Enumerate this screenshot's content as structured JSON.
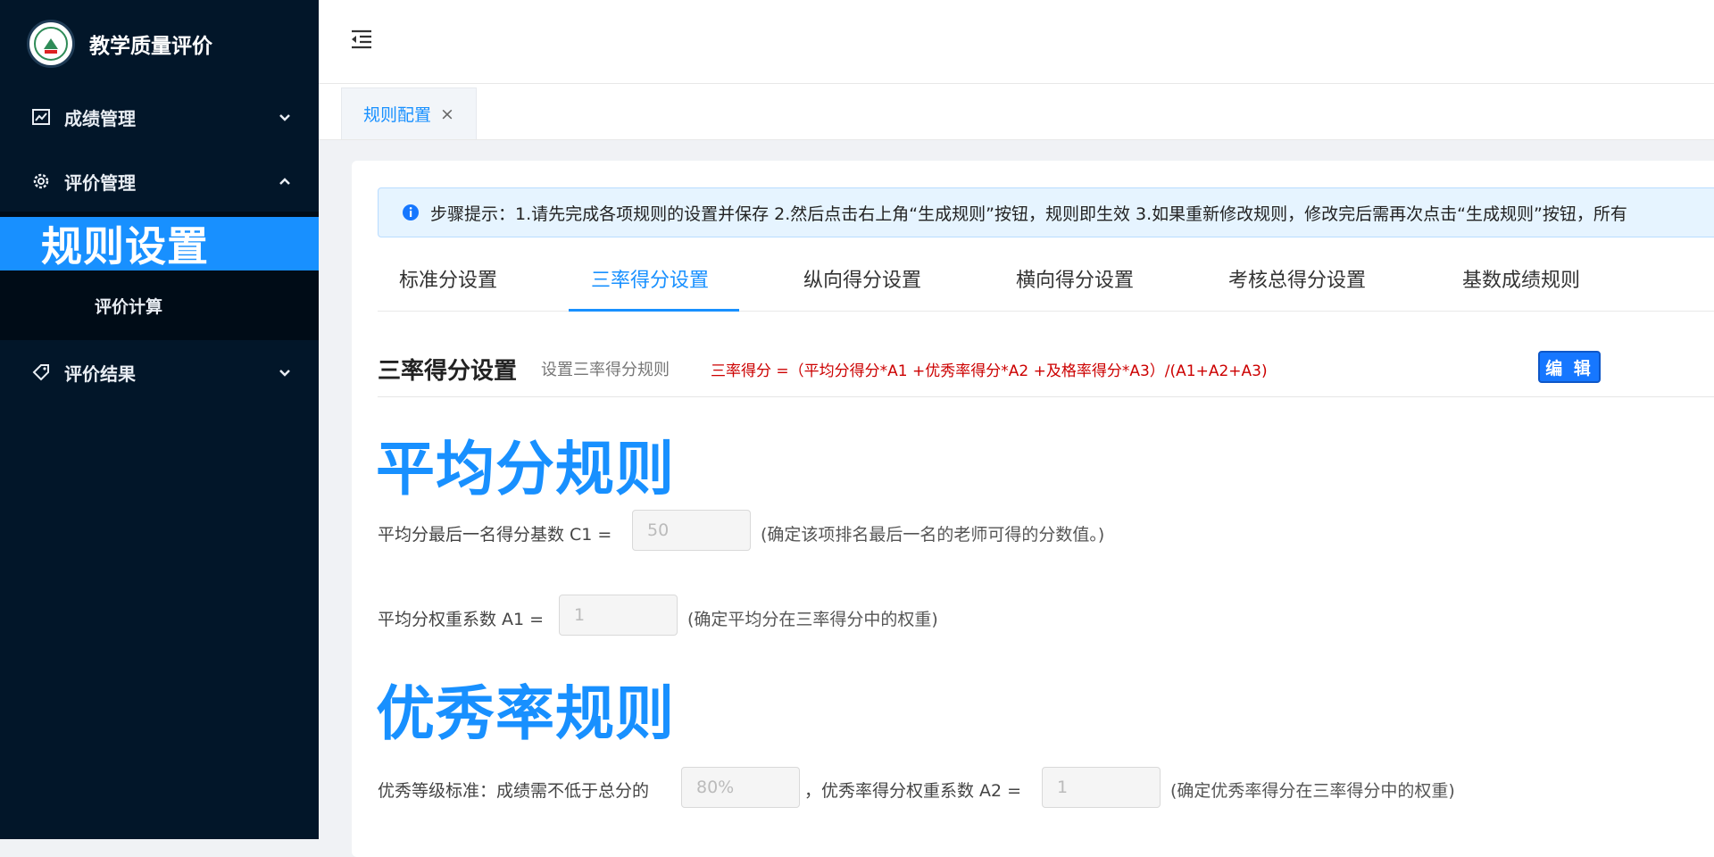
{
  "sidebar": {
    "title": "教学质量评价",
    "menu": {
      "grade": "成绩管理",
      "eval": "评价管理",
      "rules": "规则设置",
      "calc": "评价计算",
      "results": "评价结果"
    }
  },
  "tabs_bar": {
    "page_tab": "规则配置",
    "close": "×"
  },
  "alert": {
    "text": "步骤提示：1.请先完成各项规则的设置并保存 2.然后点击右上角“生成规则”按钮，规则即生效 3.如果重新修改规则，修改完后需再次点击“生成规则”按钮，所有"
  },
  "rule_tabs": [
    "标准分设置",
    "三率得分设置",
    "纵向得分设置",
    "横向得分设置",
    "考核总得分设置",
    "基数成绩规则"
  ],
  "section": {
    "title": "三率得分设置",
    "desc": "设置三率得分规则",
    "formula": "三率得分 =（平均分得分*A1 +优秀率得分*A2 +及格率得分*A3）/(A1+A2+A3)",
    "edit": "编 辑"
  },
  "average": {
    "heading": "平均分规则",
    "c1_label": "平均分最后一名得分基数 C1 =",
    "c1_value": "50",
    "c1_hint": "(确定该项排名最后一名的老师可得的分数值。)",
    "a1_label": "平均分权重系数 A1 =",
    "a1_value": "1",
    "a1_hint": "(确定平均分在三率得分中的权重)"
  },
  "excellent": {
    "heading": "优秀率规则",
    "std_label": "优秀等级标准：成绩需不低于总分的",
    "std_value": "80%",
    "a2_label": "，优秀率得分权重系数 A2 =",
    "a2_value": "1",
    "a2_hint": "(确定优秀率得分在三率得分中的权重)"
  },
  "colors": {
    "sidebar": "#021629",
    "primary": "#1890ff",
    "formula": "#cc0000"
  }
}
